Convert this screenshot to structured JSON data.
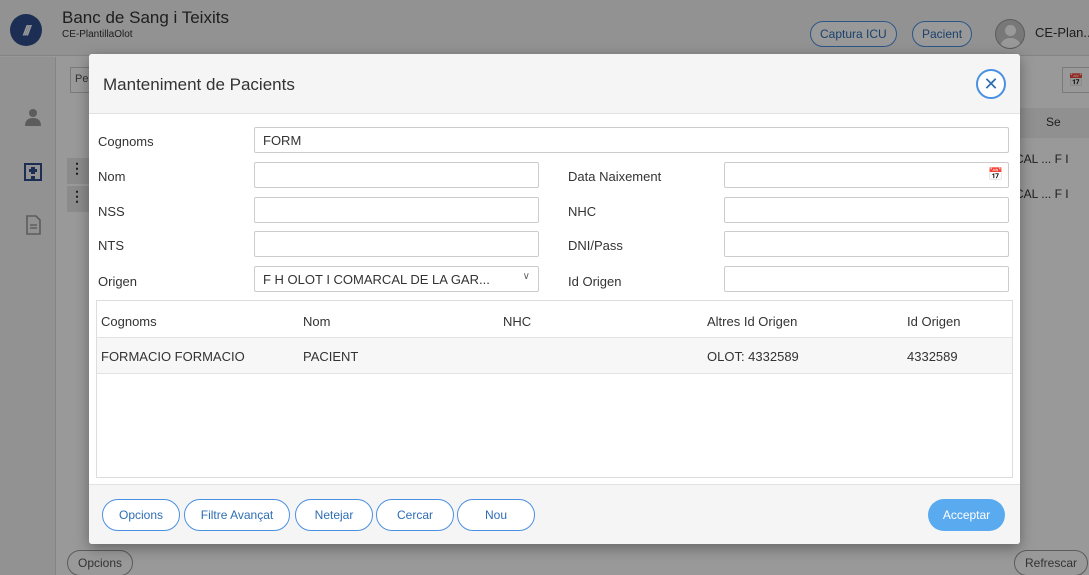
{
  "app": {
    "title": "Banc de Sang i Teixits",
    "subtitle": "CE-PlantillaOlot",
    "logo_text": "///",
    "header_buttons": {
      "captura_icu": "Captura ICU",
      "pacient": "Pacient"
    },
    "user_name": "CE-Plan...",
    "sidebar_icons": [
      "user-group-icon",
      "hospital-icon",
      "document-icon"
    ],
    "bg_filter_text": "Pe",
    "bg_table_header": "Se",
    "bg_rows": [
      "CAL ...  F I",
      "CAL ...  F I"
    ],
    "bg_bottom": {
      "options": "Opcions",
      "refresh": "Refrescar"
    }
  },
  "modal": {
    "title": "Manteniment de Pacients",
    "close_icon": "close-icon",
    "form": {
      "cognoms_label": "Cognoms",
      "cognoms_value": "FORM",
      "nom_label": "Nom",
      "nom_value": "",
      "nss_label": "NSS",
      "nss_value": "",
      "nts_label": "NTS",
      "nts_value": "",
      "origen_label": "Origen",
      "origen_value": "F H OLOT I COMARCAL DE LA GAR...",
      "data_naixement_label": "Data Naixement",
      "data_naixement_value": "",
      "nhc_label": "NHC",
      "nhc_value": "",
      "dni_label": "DNI/Pass",
      "dni_value": "",
      "id_origen_label": "Id Origen",
      "id_origen_value": ""
    },
    "table": {
      "columns": [
        "Cognoms",
        "Nom",
        "NHC",
        "Altres Id Origen",
        "Id Origen"
      ],
      "rows": [
        [
          "FORMACIO FORMACIO",
          "PACIENT",
          "",
          "OLOT: 4332589",
          "4332589"
        ]
      ]
    },
    "footer": {
      "buttons": [
        "Opcions",
        "Filtre Avançat",
        "Netejar",
        "Cercar",
        "Nou"
      ],
      "accept": "Acceptar"
    }
  },
  "colors": {
    "accent": "#4a90e2",
    "accent_text": "#2e6db4",
    "accept_bg": "#5aaaf0",
    "logo": "#2f4d8c"
  }
}
